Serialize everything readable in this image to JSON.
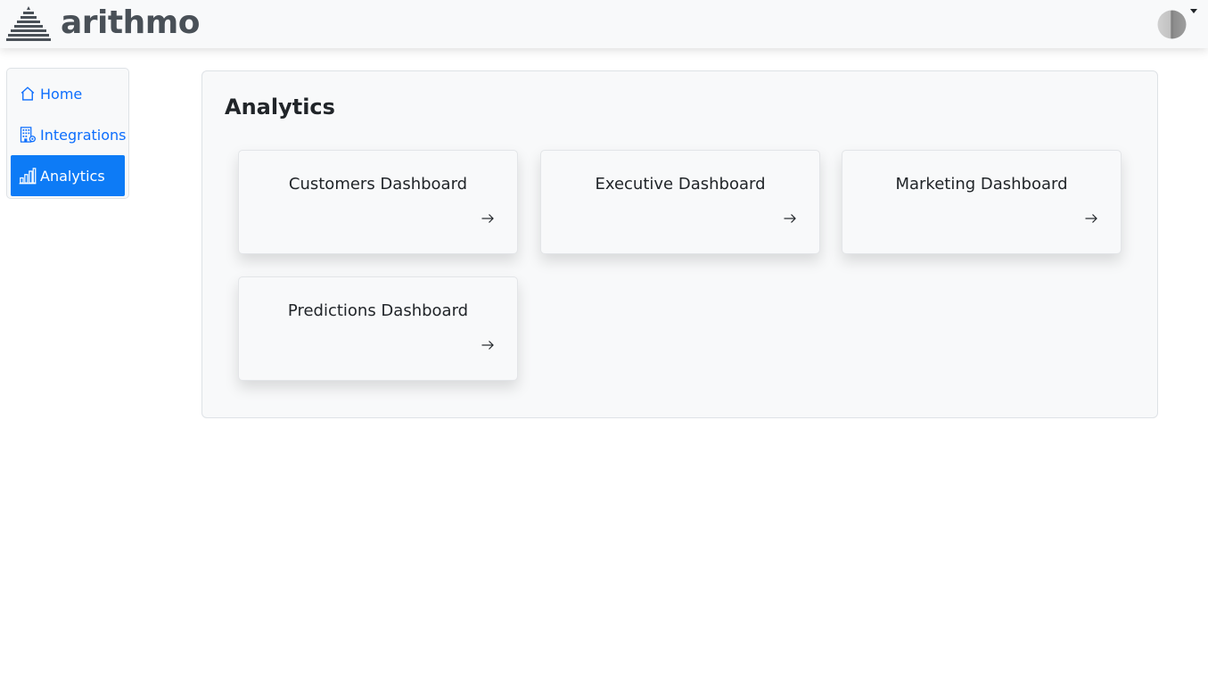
{
  "header": {
    "brand_name": "arithmo",
    "logo_icon": "stacked-pyramid-logo",
    "user_menu_icon": "user-avatar-icon"
  },
  "sidebar": {
    "items": [
      {
        "label": "Home",
        "icon": "house-icon",
        "active": false
      },
      {
        "label": "Integrations",
        "icon": "building-gear-icon",
        "active": false
      },
      {
        "label": "Analytics",
        "icon": "bar-chart-icon",
        "active": true
      }
    ]
  },
  "main": {
    "title": "Analytics",
    "cards": [
      {
        "title": "Customers Dashboard",
        "icon": "arrow-right-icon"
      },
      {
        "title": "Executive Dashboard",
        "icon": "arrow-right-icon"
      },
      {
        "title": "Marketing Dashboard",
        "icon": "arrow-right-icon"
      },
      {
        "title": "Predictions Dashboard",
        "icon": "arrow-right-icon"
      }
    ]
  },
  "colors": {
    "accent": "#0d7bf6",
    "link": "#0d6efd",
    "brand_text": "#495057",
    "panel_bg": "#f8f9fa"
  }
}
